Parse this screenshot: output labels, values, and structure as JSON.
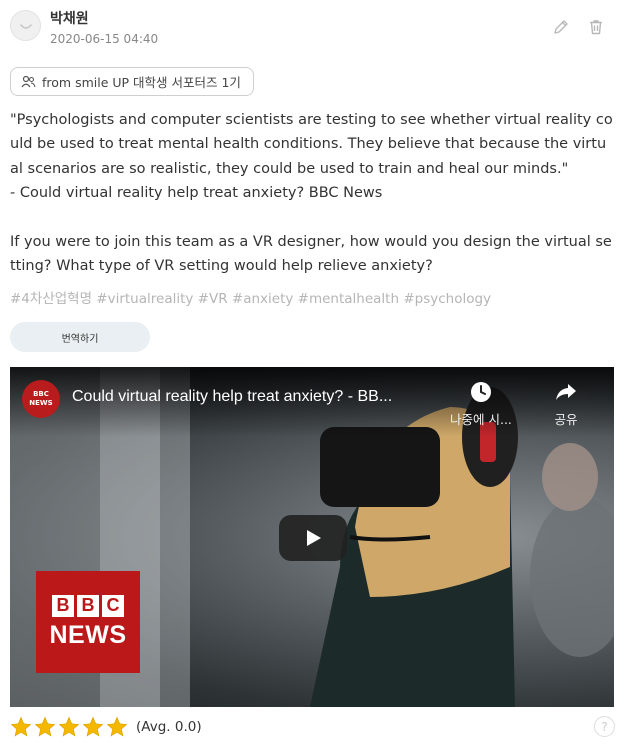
{
  "post": {
    "author": "박채원",
    "timestamp": "2020-06-15 04:40",
    "source": "from smile UP 대학생 서포터즈 1기",
    "body": "\"Psychologists and computer scientists are testing to see whether virtual reality could be used to treat mental health conditions. They believe that because the virtual scenarios are so realistic, they could be used to train and heal our minds.\"\n- Could virtual reality help treat anxiety? BBC News\n\nIf you were to join this team as a VR designer, how would you design the virtual setting? What type of VR setting would help relieve anxiety?",
    "hashtags": "#4차산업혁명 #virtualreality #VR #anxiety #mentalhealth #psychology",
    "translate_label": "번역하기"
  },
  "video": {
    "title": "Could virtual reality help treat anxiety? - BB...",
    "channel_badge": [
      "BBC",
      "NEWS"
    ],
    "watch_later_label": "나중에 시...",
    "share_label": "공유",
    "logo_letters": [
      "B",
      "B",
      "C"
    ],
    "logo_word": "NEWS"
  },
  "rating": {
    "stars": 5,
    "star_color": "#f5b800",
    "avg_label": "(Avg. 0.0)"
  },
  "icons": {
    "avatar": "user-avatar-icon",
    "edit": "pencil-icon",
    "delete": "trash-icon",
    "source": "people-icon",
    "help": "question-icon"
  },
  "help_glyph": "?"
}
